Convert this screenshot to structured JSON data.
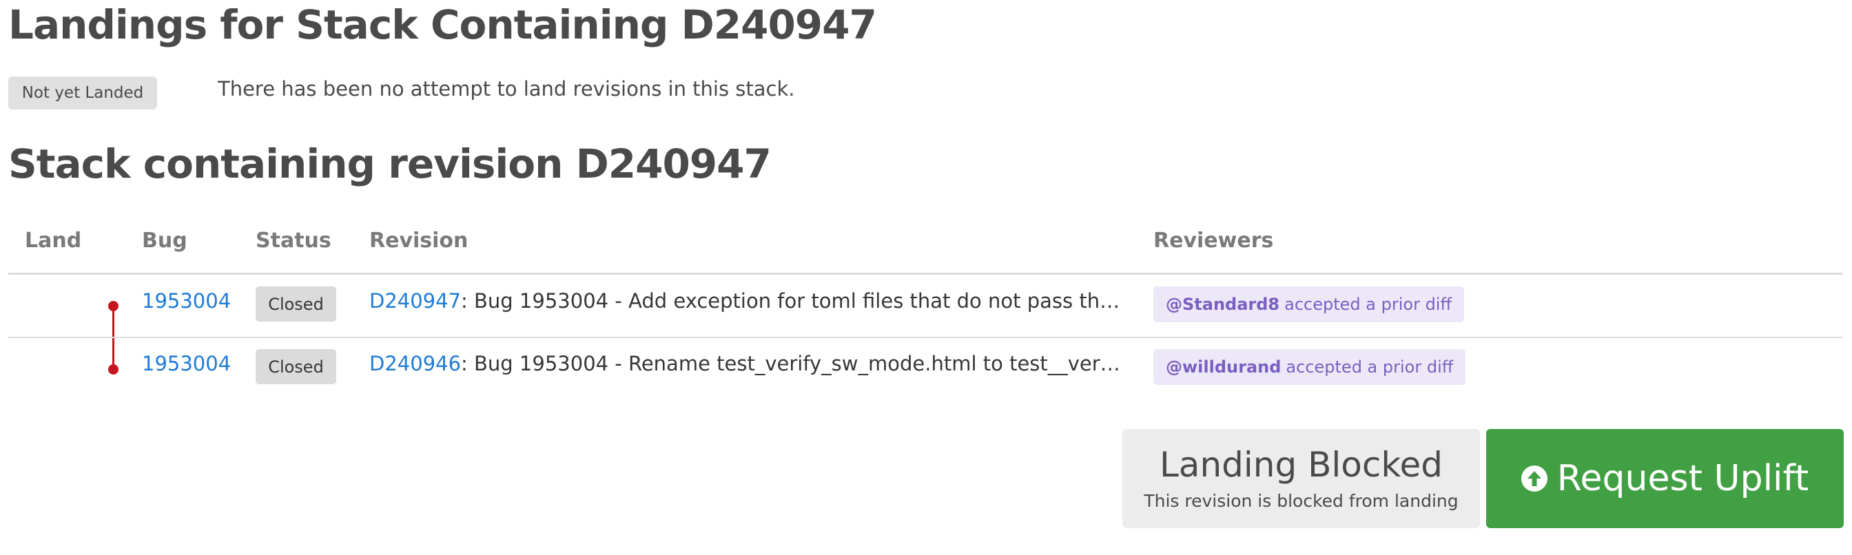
{
  "landings": {
    "title": "Landings for Stack Containing D240947",
    "status_tag": "Not yet Landed",
    "status_message": "There has been no attempt to land revisions in this stack."
  },
  "stack": {
    "title": "Stack containing revision D240947",
    "columns": [
      "Land",
      "Bug",
      "Status",
      "Revision",
      "Reviewers"
    ],
    "rows": [
      {
        "bug": "1953004",
        "status": "Closed",
        "revision_id": "D240947",
        "revision_title": ": Bug 1953004 - Add exception for toml files that do not pass the...",
        "reviewer": "@Standard8",
        "reviewer_note": "accepted a prior diff"
      },
      {
        "bug": "1953004",
        "status": "Closed",
        "revision_id": "D240946",
        "revision_title": ": Bug 1953004 - Rename test_verify_sw_mode.html to test__veri...",
        "reviewer": "@willdurand",
        "reviewer_note": "accepted a prior diff"
      }
    ]
  },
  "actions": {
    "blocked_label": "Landing Blocked",
    "blocked_sub": "This revision is blocked from landing",
    "uplift_label": "Request Uplift",
    "uplift_icon": "arrow-up-circle-icon"
  },
  "colors": {
    "link": "#1f7bd6",
    "graph": "#c4161c",
    "uplift": "#41a043",
    "reviewer_badge": "#ece8f8"
  }
}
